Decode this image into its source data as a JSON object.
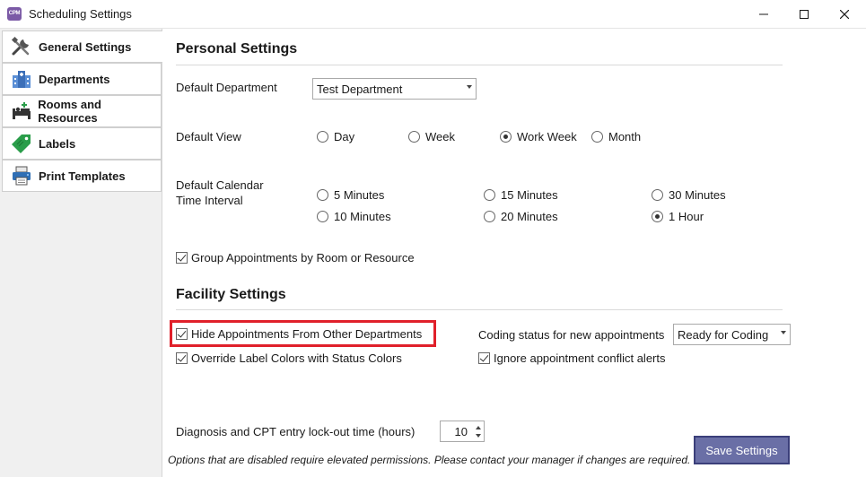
{
  "window": {
    "icon_text": "CPM",
    "title": "Scheduling Settings"
  },
  "sidebar": {
    "items": [
      {
        "label": "General Settings",
        "icon": "tools-icon"
      },
      {
        "label": "Departments",
        "icon": "building-icon"
      },
      {
        "label": "Rooms and Resources",
        "icon": "bed-icon"
      },
      {
        "label": "Labels",
        "icon": "tag-icon"
      },
      {
        "label": "Print Templates",
        "icon": "printer-icon"
      }
    ]
  },
  "personal": {
    "title": "Personal Settings",
    "default_department_label": "Default Department",
    "default_department_value": "Test Department",
    "default_view_label": "Default View",
    "views": [
      {
        "label": "Day",
        "selected": false
      },
      {
        "label": "Week",
        "selected": false
      },
      {
        "label": "Work Week",
        "selected": true
      },
      {
        "label": "Month",
        "selected": false
      }
    ],
    "interval_label_line1": "Default Calendar",
    "interval_label_line2": "Time Interval",
    "intervals": [
      {
        "label": "5 Minutes",
        "selected": false
      },
      {
        "label": "15 Minutes",
        "selected": false
      },
      {
        "label": "30 Minutes",
        "selected": false
      },
      {
        "label": "10 Minutes",
        "selected": false
      },
      {
        "label": "20 Minutes",
        "selected": false
      },
      {
        "label": "1 Hour",
        "selected": true
      }
    ],
    "group_by_room_label": "Group Appointments by Room or Resource",
    "group_by_room_checked": true
  },
  "facility": {
    "title": "Facility Settings",
    "hide_other_depts_label": "Hide Appointments From Other Departments",
    "hide_other_depts_checked": true,
    "override_label_colors_label": "Override Label Colors with Status Colors",
    "override_label_colors_checked": true,
    "coding_status_label": "Coding status for new appointments",
    "coding_status_value": "Ready for Coding",
    "ignore_conflict_label": "Ignore appointment conflict alerts",
    "ignore_conflict_checked": true
  },
  "lockout": {
    "label": "Diagnosis and CPT entry lock-out time (hours)",
    "value": "10"
  },
  "footer": {
    "save_label": "Save Settings",
    "note": "Options that are disabled require elevated permissions.  Please contact your manager if changes are required."
  },
  "colors": {
    "highlight": "#e0202a",
    "save_button": "#6a6fa6"
  }
}
